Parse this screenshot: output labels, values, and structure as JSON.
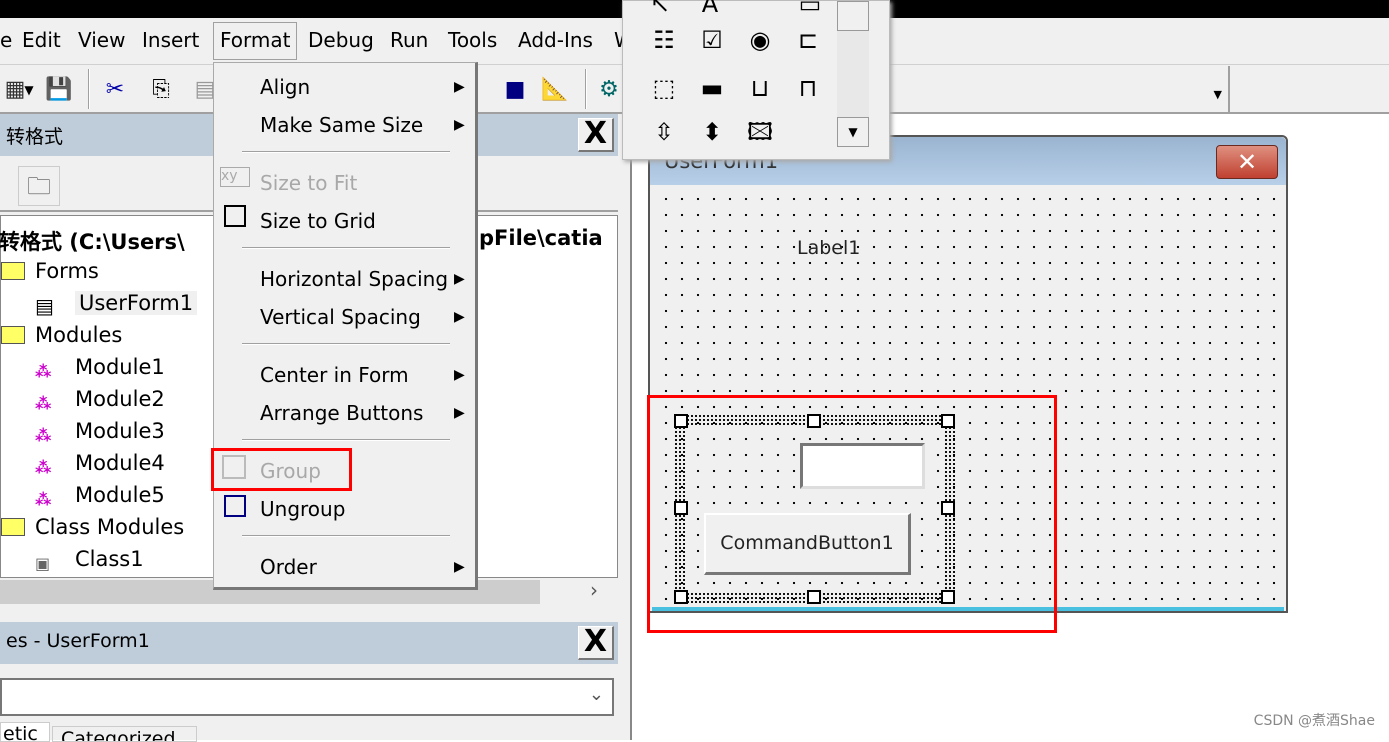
{
  "menubar": {
    "items": [
      "e",
      "Edit",
      "View",
      "Insert",
      "Format",
      "Debug",
      "Run",
      "Tools",
      "Add-Ins",
      "W"
    ]
  },
  "project": {
    "title": "转格式",
    "path_left": "转格式 (C:\\Users\\",
    "path_right": "pFile\\catia",
    "close": "X",
    "tree": [
      {
        "label": "Forms",
        "type": "folder"
      },
      {
        "label": "UserForm1",
        "type": "form"
      },
      {
        "label": "Modules",
        "type": "folder"
      },
      {
        "label": "Module1",
        "type": "module"
      },
      {
        "label": "Module2",
        "type": "module"
      },
      {
        "label": "Module3",
        "type": "module"
      },
      {
        "label": "Module4",
        "type": "module"
      },
      {
        "label": "Module5",
        "type": "module"
      },
      {
        "label": "Class Modules",
        "type": "folder"
      },
      {
        "label": "Class1",
        "type": "class"
      }
    ]
  },
  "properties": {
    "title": "es - UserForm1",
    "close": "X",
    "tabs": [
      "etic",
      "Categorized"
    ]
  },
  "format_menu": {
    "items": [
      {
        "label": "Align",
        "submenu": true,
        "enabled": true
      },
      {
        "label": "Make Same Size",
        "submenu": true,
        "enabled": true
      },
      {
        "label": "Size to Fit",
        "enabled": false
      },
      {
        "label": "Size to Grid",
        "enabled": true
      },
      {
        "label": "Horizontal Spacing",
        "submenu": true,
        "enabled": true
      },
      {
        "label": "Vertical Spacing",
        "submenu": true,
        "enabled": true
      },
      {
        "label": "Center in Form",
        "submenu": true,
        "enabled": true
      },
      {
        "label": "Arrange Buttons",
        "submenu": true,
        "enabled": true
      },
      {
        "label": "Group",
        "enabled": false
      },
      {
        "label": "Ungroup",
        "enabled": true
      },
      {
        "label": "Order",
        "submenu": true,
        "enabled": true
      }
    ]
  },
  "userform": {
    "title": "UserForm1",
    "close": "✕",
    "label": "Label1",
    "button": "CommandButton1"
  },
  "highlight_color": "#ff0000",
  "watermark": "CSDN @煮酒Shae"
}
